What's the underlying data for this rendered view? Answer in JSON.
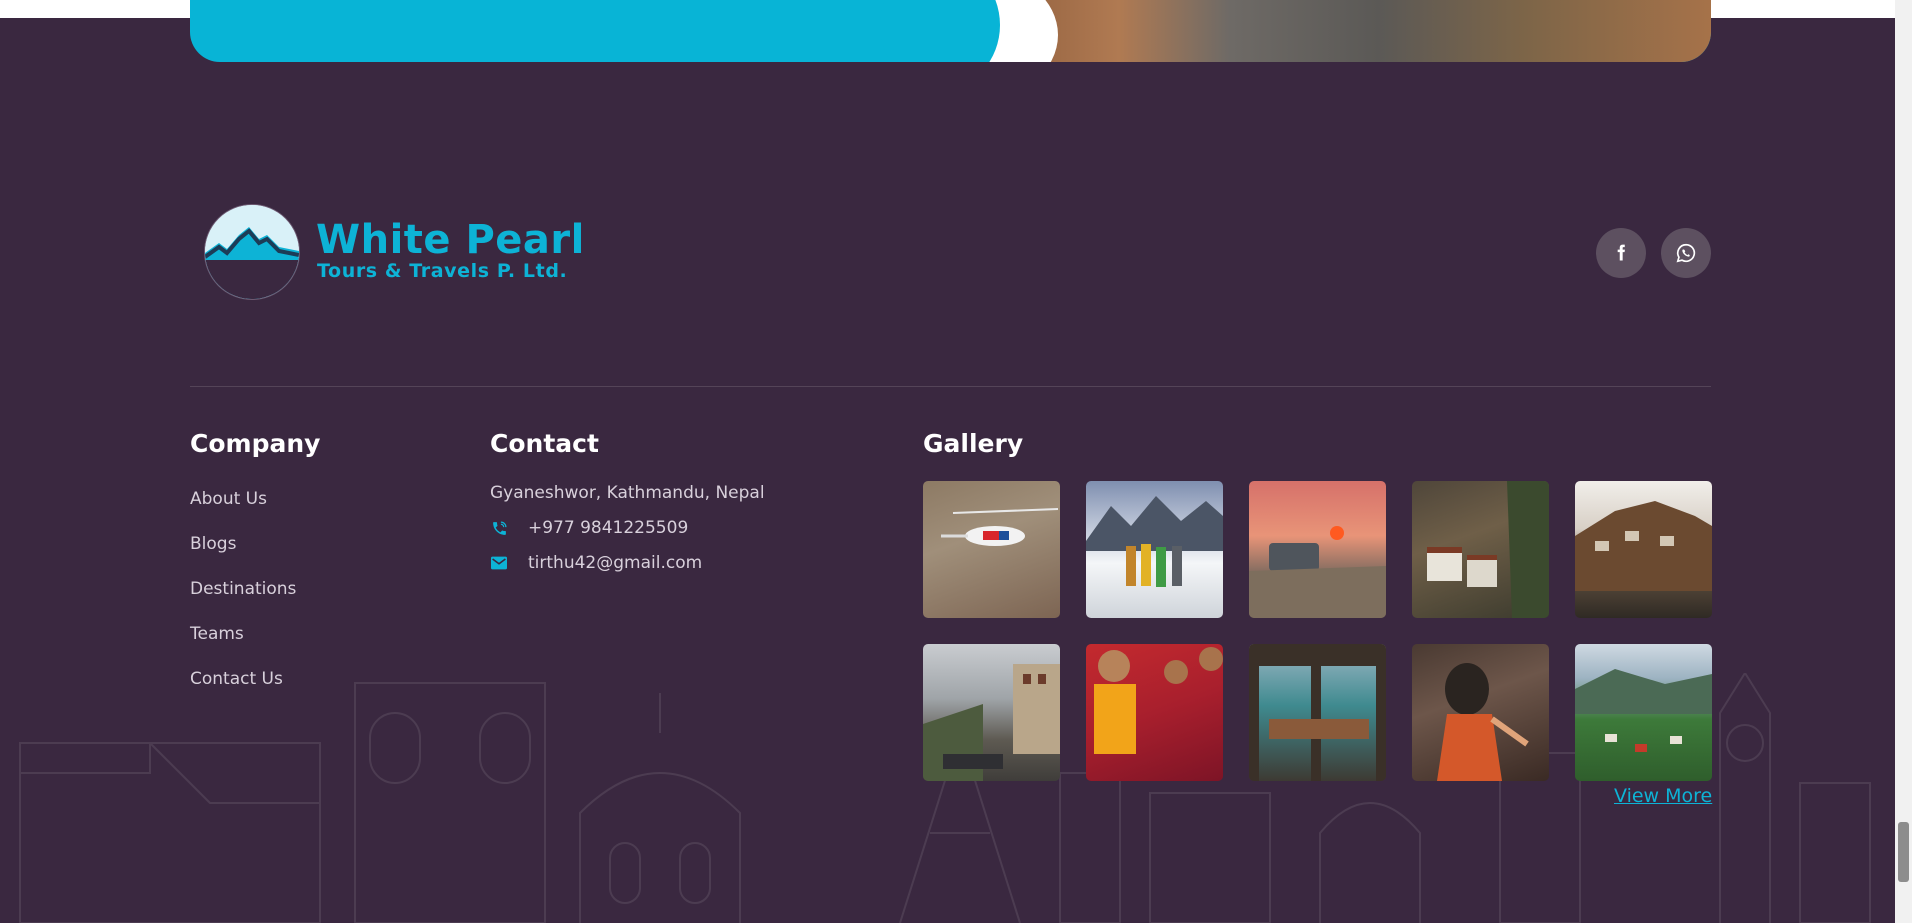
{
  "brand": {
    "name": "White Pearl",
    "tagline": "Tours & Travels P. Ltd."
  },
  "social": {
    "facebook_icon": "facebook-icon",
    "whatsapp_icon": "whatsapp-icon"
  },
  "company": {
    "title": "Company",
    "links": [
      "About Us",
      "Blogs",
      "Destinations",
      "Teams",
      "Contact Us"
    ]
  },
  "contact": {
    "title": "Contact",
    "address": "Gyaneshwor, Kathmandu, Nepal",
    "phone": "+977 9841225509",
    "email": "tirthu42@gmail.com",
    "phone_icon": "phone-icon",
    "email_icon": "mail-icon"
  },
  "gallery": {
    "title": "Gallery",
    "view_more": "View More",
    "images": [
      "helicopter-image",
      "trekkers-snow-image",
      "sunset-jeep-image",
      "cliff-monastery-image",
      "hillside-village-image",
      "street-town-image",
      "young-monks-image",
      "valley-window-image",
      "masked-dancer-image",
      "valley-town-image"
    ]
  },
  "colors": {
    "background": "#3a2840",
    "accent": "#0db3d6",
    "banner": "#08b4d6"
  }
}
